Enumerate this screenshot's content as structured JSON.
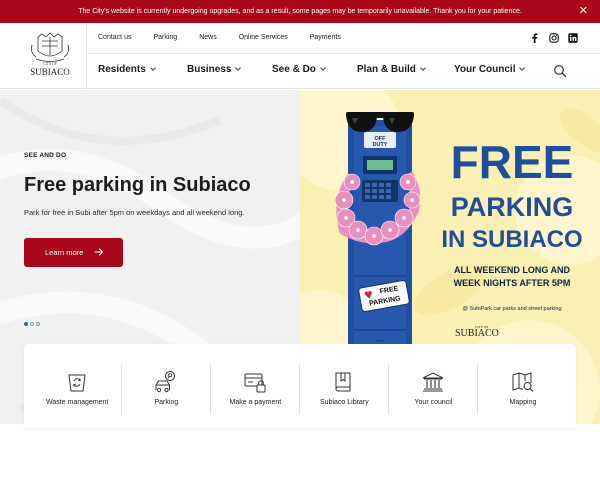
{
  "alert": {
    "message": "The City's website is currently undergoing upgrades, and as a result, some pages may be temporarily unavailable. Thank you for your patience.",
    "close_glyph": "✕"
  },
  "logo": {
    "small_text": "CITY OF",
    "name": "SUBIACO"
  },
  "utility_nav": [
    "Contact us",
    "Parking",
    "News",
    "Online Services",
    "Payments"
  ],
  "social": [
    "facebook-icon",
    "instagram-icon",
    "linkedin-icon"
  ],
  "main_nav": [
    "Residents",
    "Business",
    "See & Do",
    "Plan & Build",
    "Your Council"
  ],
  "hero": {
    "eyebrow": "SEE AND DO",
    "title": "Free parking in Subiaco",
    "description": "Park for free in Subi after 5pm on weekdays and all weekend long.",
    "button_label": "Learn more",
    "slide_count": 3,
    "active_slide": 1
  },
  "promo": {
    "meter_label_1": "OFF",
    "meter_label_2": "DUTY",
    "sticker_line_1": "FREE",
    "sticker_line_2": "PARKING",
    "heading_1": "FREE",
    "heading_2": "PARKING",
    "heading_3": "IN SUBIACO",
    "subheading_1": "ALL WEEKEND LONG AND",
    "subheading_2": "WEEK NIGHTS AFTER 5PM",
    "note": "@ SubiPark car parks and street parking",
    "logo_small": "CITY OF",
    "logo_name": "SUBIACO"
  },
  "quick_links": [
    {
      "label": "Waste management",
      "icon": "recycle-bin-icon"
    },
    {
      "label": "Parking",
      "icon": "car-parking-icon"
    },
    {
      "label": "Make a payment",
      "icon": "payment-icon"
    },
    {
      "label": "Subiaco Library",
      "icon": "book-icon"
    },
    {
      "label": "Your council",
      "icon": "council-building-icon"
    },
    {
      "label": "Mapping",
      "icon": "map-icon"
    }
  ],
  "colors": {
    "brand_red": "#a8081a",
    "promo_blue": "#1f4f9c",
    "promo_yellow": "#fbf0b4",
    "lei_pink": "#e98fc0"
  }
}
